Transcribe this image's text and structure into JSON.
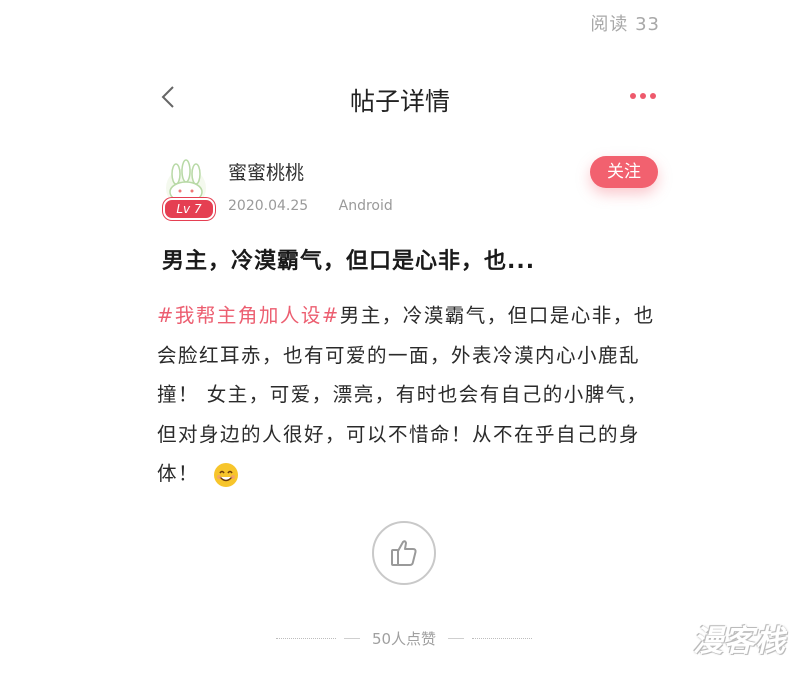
{
  "read_count": "阅读 33",
  "nav": {
    "title": "帖子详情"
  },
  "author": {
    "name": "蜜蜜桃桃",
    "level": "Lv  7",
    "date": "2020.04.25",
    "platform": "Android",
    "follow_label": "关注"
  },
  "post": {
    "title": "男主，冷漠霸气，但口是心非，也...",
    "tag": "#我帮主角加人设#",
    "body": "男主，冷漠霸气，但口是心非，也会脸红耳赤，也有可爱的一面，外表冷漠内心小鹿乱撞！ 女主，可爱，漂亮，有时也会有自己的小脾气，但对身边的人很好，可以不惜命！从不在乎自己的身体！",
    "emoji": "smiling-face-icon"
  },
  "likes": {
    "text": "50人点赞"
  },
  "watermark": "漫客栈",
  "colors": {
    "accent": "#f2616f",
    "tag": "#ec5e70"
  }
}
